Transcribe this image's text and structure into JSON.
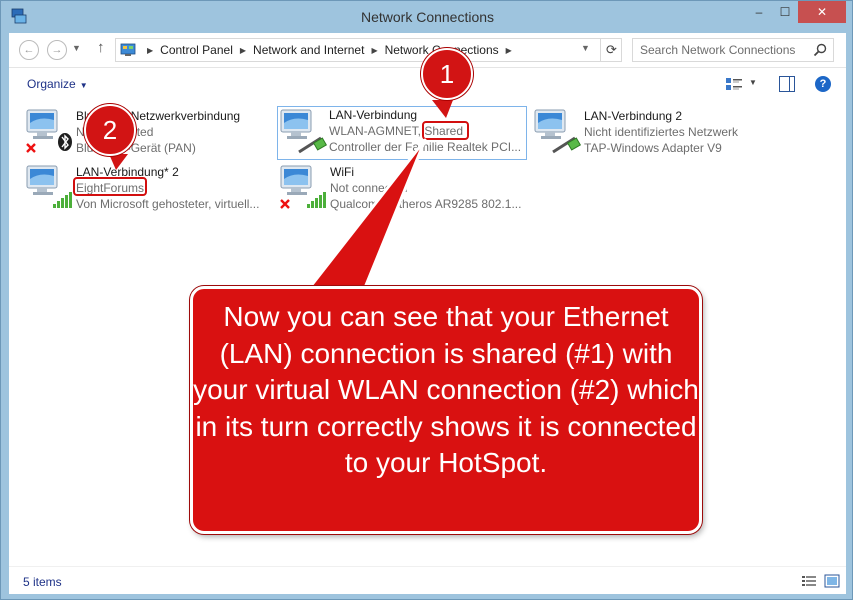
{
  "window": {
    "title": "Network Connections"
  },
  "titlebar": {
    "minimize_label": "–",
    "maximize_label": "☐",
    "close_label": "✕"
  },
  "navigation": {
    "back_label": "←",
    "forward_label": "→",
    "recent_label": "▼",
    "up_label": "↑"
  },
  "address": {
    "breadcrumbs": [
      "Control Panel",
      "Network and Internet",
      "Network Connections"
    ],
    "separator": "▶",
    "dropdown_label": "▼",
    "refresh_label": "⟳"
  },
  "search": {
    "placeholder": "Search Network Connections"
  },
  "toolbar": {
    "organize_label": "Organize",
    "organize_caret": "▼",
    "view_caret": "▼",
    "help_label": "?"
  },
  "connections": [
    {
      "name": "Bluetooth-Netzwerkverbindung",
      "status": "Not connected",
      "device": "Bluetooth-Gerät (PAN)",
      "icon": "bluetooth-network-icon",
      "overlay": "disconnected-x"
    },
    {
      "name": "LAN-Verbindung",
      "status": "WLAN-AGMNET, Shared",
      "device": "Controller der Familie Realtek PCI...",
      "icon": "ethernet-network-icon",
      "selected": true
    },
    {
      "name": "LAN-Verbindung 2",
      "status": "Nicht identifiziertes Netzwerk",
      "device": "TAP-Windows Adapter V9",
      "icon": "ethernet-network-icon"
    },
    {
      "name": "LAN-Verbindung* 2",
      "status": "EightForums",
      "device": "Von Microsoft gehosteter, virtuell...",
      "icon": "wireless-network-icon"
    },
    {
      "name": "WiFi",
      "status": "Not connected",
      "device": "Qualcomm Atheros AR9285 802.1...",
      "icon": "wireless-network-icon",
      "overlay": "disconnected-x"
    }
  ],
  "annotations": {
    "badge1": "1",
    "badge2": "2",
    "callout": "Now you can see that your Ethernet (LAN) connection is shared (#1) with your virtual WLAN connection (#2) which in its turn correctly shows it is connected to your HotSpot.",
    "color": "#d91111"
  },
  "status_bar": {
    "items_count": "5 items"
  }
}
